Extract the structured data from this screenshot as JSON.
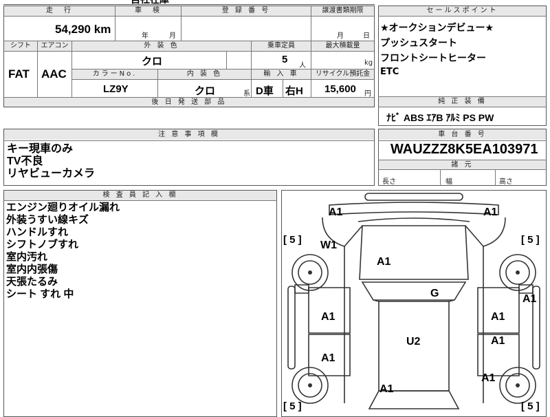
{
  "top": {
    "fragment": "自社在庫"
  },
  "headers": {
    "mileage": "走　行",
    "inspection": "車　検",
    "registration": "登 録 番 号",
    "transfer": "譲渡書類期限",
    "shift": "シフト",
    "aircon": "エアコン",
    "exterior_color": "外 装 色",
    "capacity": "乗車定員",
    "max_load": "最大積載量",
    "color_no": "カラーNo.",
    "interior_color": "内 装 色",
    "import": "輸 入 車",
    "recycle": "リサイクル預託金",
    "parts": "後 日 発 送 部 品",
    "sales_point": "セールスポイント",
    "genuine": "純 正 装 備",
    "notes": "注 意 事 項 欄",
    "chassis": "車 台 番 号",
    "dimensions": "諸 元",
    "inspector": "検 査 員 記 入 欄"
  },
  "values": {
    "mileage": "54,290",
    "mileage_unit": "km",
    "inspection_year_unit": "年",
    "inspection_month_unit": "月",
    "transfer_month_unit": "月",
    "transfer_day_unit": "日",
    "shift": "FAT",
    "aircon": "AAC",
    "exterior_color": "クロ",
    "capacity": "5",
    "capacity_unit": "人",
    "max_load_unit": "kg",
    "color_no": "LZ9Y",
    "interior_color": "クロ",
    "interior_suffix": "系",
    "import_drive": "D車",
    "import_handle": "右H",
    "recycle": "15,600",
    "recycle_unit": "円",
    "chassis": "WAUZZZ8K5EA103971",
    "dim_length": "長さ",
    "dim_width": "幅",
    "dim_height": "高さ"
  },
  "sales_points": [
    "★オークションデビュー★",
    "プッシュスタート",
    "フロントシートヒーター",
    "ETC"
  ],
  "genuine_equipment": "ﾅﾋﾞ ABS ｴｱB ｱﾙﾐ PS PW",
  "notes": [
    "キー現車のみ",
    "TV不良",
    "リヤビューカメラ"
  ],
  "inspector_notes": [
    "エンジン廻りオイル漏れ",
    "外装うすい線キズ",
    "ハンドルすれ",
    "シフトノブすれ",
    "室内汚れ",
    "室内内張傷",
    "天張たるみ",
    "シート すれ 中"
  ],
  "diagram": {
    "marks": {
      "front_left": "A1",
      "front_right": "A1",
      "fender_left": "W1",
      "hood": "A1",
      "glass": "G",
      "roof": "U2",
      "door_fl": "A1",
      "door_fr": "A1",
      "door_rl": "A1",
      "door_rr": "A1",
      "pillar_r": "A1",
      "rear_right": "A1",
      "trunk": "A1"
    },
    "tire_scales": [
      "[ 5 ]",
      "[ 5 ]",
      "[ 5 ]",
      "[ 5 ]"
    ]
  }
}
